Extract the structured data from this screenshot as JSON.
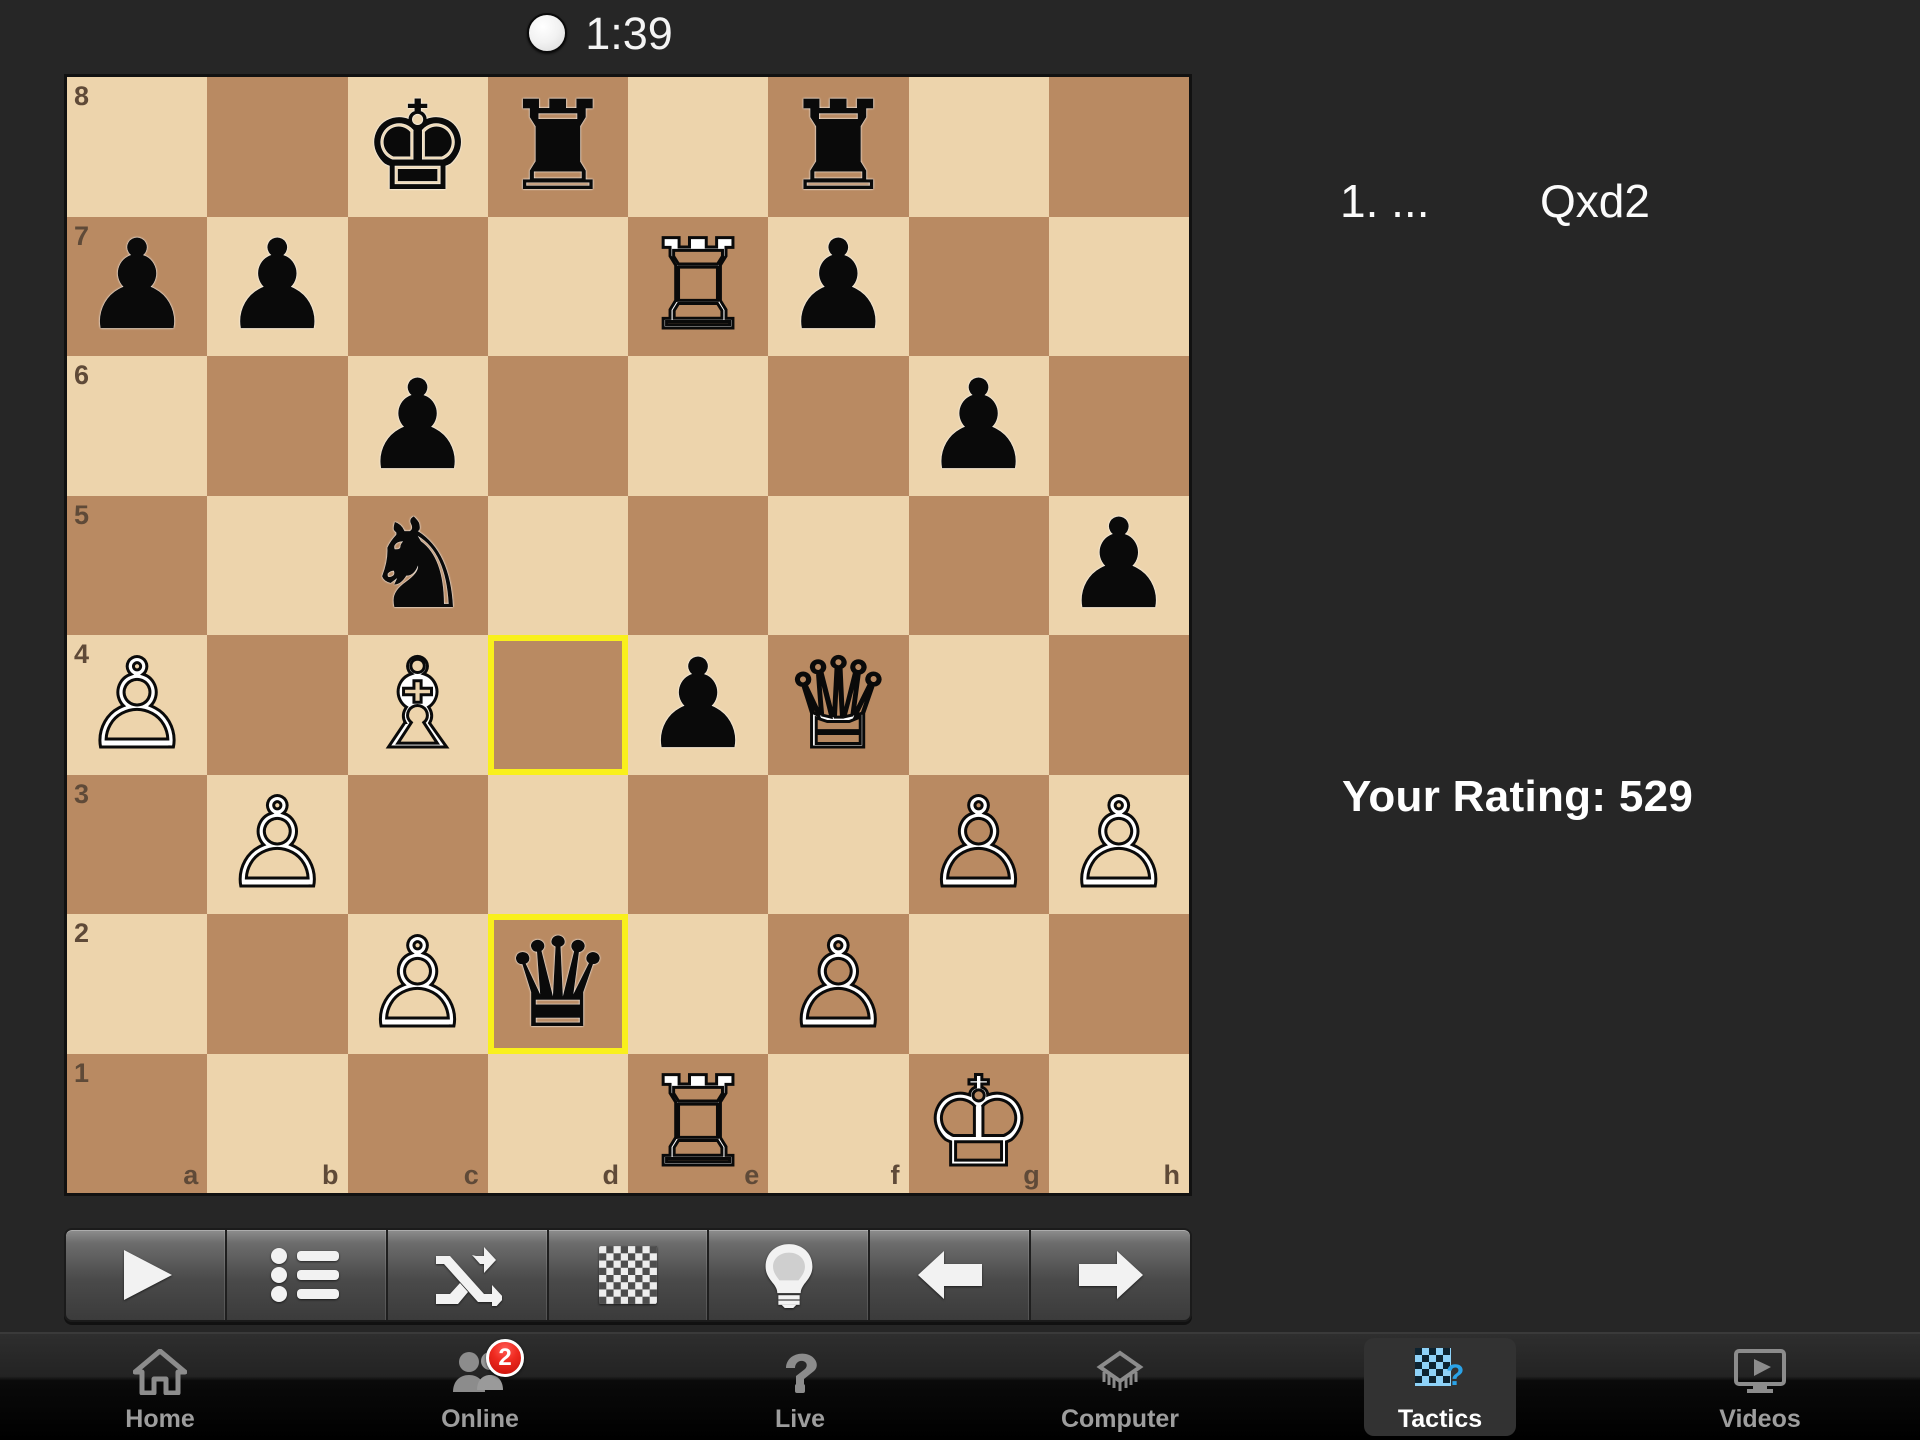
{
  "header": {
    "timer": "1:39",
    "turn_indicator": "white-to-move-dot"
  },
  "board": {
    "light_square_color": "#edd4ac",
    "dark_square_color": "#b98a62",
    "highlight_color": "#f9f01c",
    "orientation": "white",
    "rank_labels": [
      "8",
      "7",
      "6",
      "5",
      "4",
      "3",
      "2",
      "1"
    ],
    "file_labels": [
      "a",
      "b",
      "c",
      "d",
      "e",
      "f",
      "g",
      "h"
    ],
    "highlighted_squares": [
      "d4",
      "d2"
    ],
    "pieces": [
      {
        "square": "c8",
        "piece": "black-king",
        "glyph": "♚",
        "color": "b"
      },
      {
        "square": "d8",
        "piece": "black-rook",
        "glyph": "♜",
        "color": "b"
      },
      {
        "square": "f8",
        "piece": "black-rook",
        "glyph": "♜",
        "color": "b"
      },
      {
        "square": "a7",
        "piece": "black-pawn",
        "glyph": "♟",
        "color": "b"
      },
      {
        "square": "b7",
        "piece": "black-pawn",
        "glyph": "♟",
        "color": "b"
      },
      {
        "square": "e7",
        "piece": "white-rook",
        "glyph": "♖",
        "color": "w"
      },
      {
        "square": "f7",
        "piece": "black-pawn",
        "glyph": "♟",
        "color": "b"
      },
      {
        "square": "c6",
        "piece": "black-pawn",
        "glyph": "♟",
        "color": "b"
      },
      {
        "square": "g6",
        "piece": "black-pawn",
        "glyph": "♟",
        "color": "b"
      },
      {
        "square": "c5",
        "piece": "black-knight",
        "glyph": "♞",
        "color": "b"
      },
      {
        "square": "h5",
        "piece": "black-pawn",
        "glyph": "♟",
        "color": "b"
      },
      {
        "square": "a4",
        "piece": "white-pawn",
        "glyph": "♙",
        "color": "w"
      },
      {
        "square": "c4",
        "piece": "white-bishop",
        "glyph": "♗",
        "color": "w"
      },
      {
        "square": "e4",
        "piece": "black-pawn",
        "glyph": "♟",
        "color": "b"
      },
      {
        "square": "f4",
        "piece": "white-queen",
        "glyph": "♕",
        "color": "w"
      },
      {
        "square": "b3",
        "piece": "white-pawn",
        "glyph": "♙",
        "color": "w"
      },
      {
        "square": "g3",
        "piece": "white-pawn",
        "glyph": "♙",
        "color": "w"
      },
      {
        "square": "h3",
        "piece": "white-pawn",
        "glyph": "♙",
        "color": "w"
      },
      {
        "square": "c2",
        "piece": "white-pawn",
        "glyph": "♙",
        "color": "w"
      },
      {
        "square": "d2",
        "piece": "black-queen",
        "glyph": "♛",
        "color": "b"
      },
      {
        "square": "f2",
        "piece": "white-pawn",
        "glyph": "♙",
        "color": "w"
      },
      {
        "square": "e1",
        "piece": "white-rook",
        "glyph": "♖",
        "color": "w"
      },
      {
        "square": "g1",
        "piece": "white-king",
        "glyph": "♔",
        "color": "w"
      }
    ]
  },
  "toolbar": {
    "buttons": [
      {
        "name": "play-button",
        "icon": "play-icon"
      },
      {
        "name": "moves-list-button",
        "icon": "list-icon"
      },
      {
        "name": "shuffle-button",
        "icon": "shuffle-icon"
      },
      {
        "name": "board-button",
        "icon": "chessboard-icon"
      },
      {
        "name": "hint-button",
        "icon": "lightbulb-icon"
      },
      {
        "name": "back-button",
        "icon": "arrow-left-icon"
      },
      {
        "name": "forward-button",
        "icon": "arrow-right-icon"
      }
    ]
  },
  "info": {
    "move_number": "1. ...",
    "move_san": "Qxd2",
    "rating_text": "Your Rating: 529"
  },
  "tabbar": {
    "tabs": [
      {
        "label": "Home",
        "icon": "home-icon",
        "active": false,
        "badge": null
      },
      {
        "label": "Online",
        "icon": "people-icon",
        "active": false,
        "badge": "2"
      },
      {
        "label": "Live",
        "icon": "hand-icon",
        "active": false,
        "badge": null
      },
      {
        "label": "Computer",
        "icon": "chip-icon",
        "active": false,
        "badge": null
      },
      {
        "label": "Tactics",
        "icon": "tactics-icon",
        "active": true,
        "badge": null
      },
      {
        "label": "Videos",
        "icon": "video-icon",
        "active": false,
        "badge": null
      }
    ]
  }
}
